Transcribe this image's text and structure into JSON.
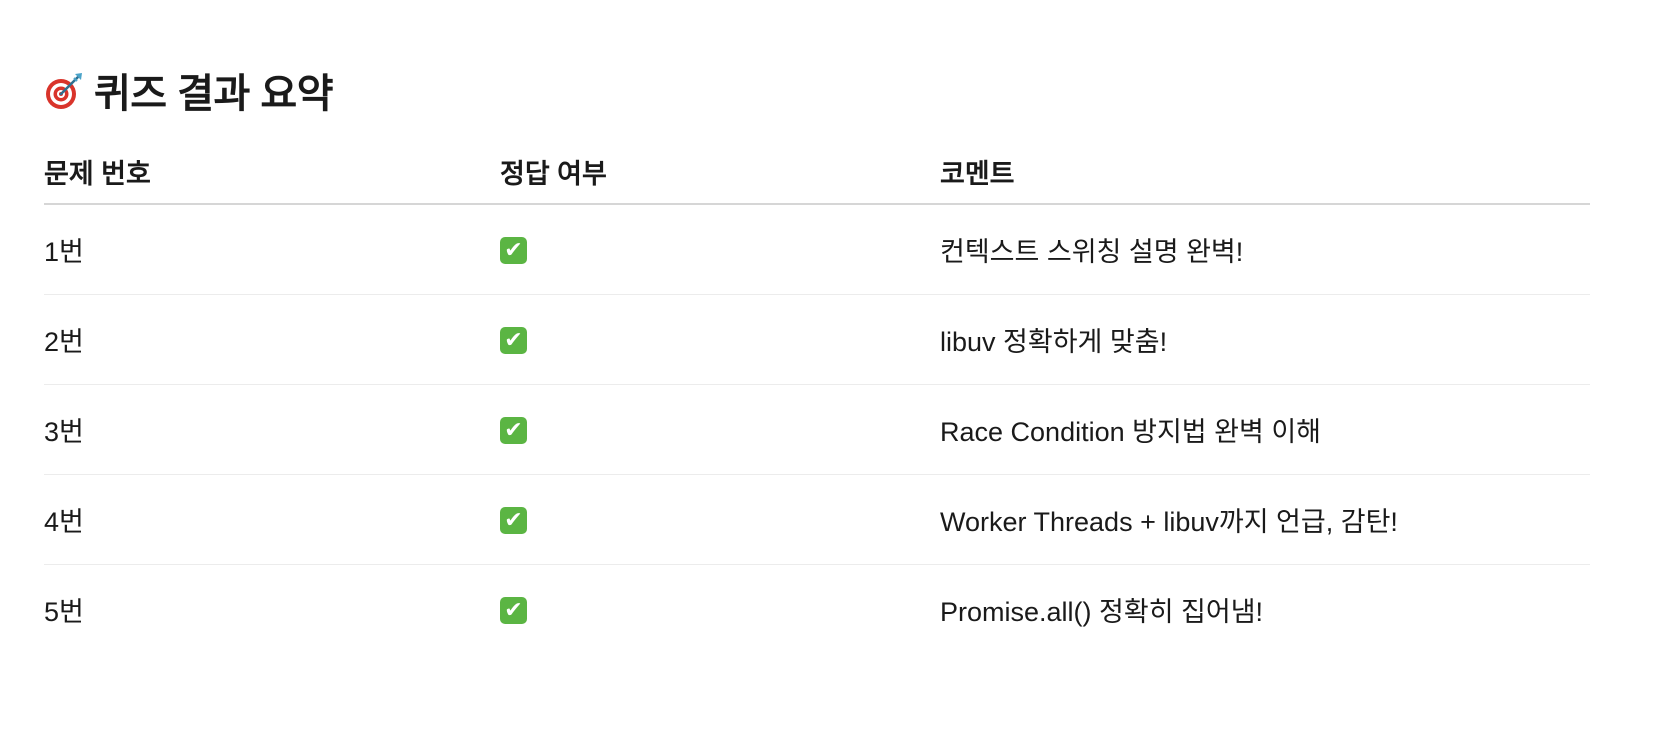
{
  "heading": {
    "icon": "dart-target-icon",
    "title": "퀴즈 결과 요약"
  },
  "table": {
    "headers": [
      "문제 번호",
      "정답 여부",
      "코멘트"
    ],
    "rows": [
      {
        "number": "1번",
        "result": "✔",
        "result_icon": "check-mark-icon",
        "comment": "컨텍스트 스위칭 설명 완벽!"
      },
      {
        "number": "2번",
        "result": "✔",
        "result_icon": "check-mark-icon",
        "comment": "libuv 정확하게 맞춤!"
      },
      {
        "number": "3번",
        "result": "✔",
        "result_icon": "check-mark-icon",
        "comment": "Race Condition 방지법 완벽 이해"
      },
      {
        "number": "4번",
        "result": "✔",
        "result_icon": "check-mark-icon",
        "comment": "Worker Threads + libuv까지 언급, 감탄!"
      },
      {
        "number": "5번",
        "result": "✔",
        "result_icon": "check-mark-icon",
        "comment": "Promise.all() 정확히 집어냄!"
      }
    ]
  },
  "colors": {
    "check_green": "#5bb543",
    "header_rule": "#d6d6d6",
    "row_rule": "#ececec"
  }
}
